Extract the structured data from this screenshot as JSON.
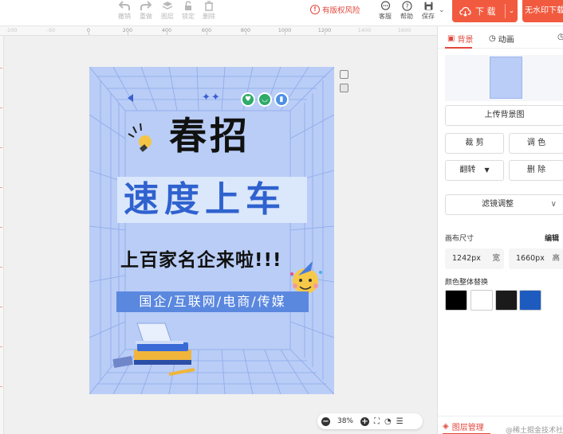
{
  "toolbar": {
    "tools": [
      {
        "label": "撤销",
        "icon": "undo-icon"
      },
      {
        "label": "重做",
        "icon": "redo-icon"
      },
      {
        "label": "图层",
        "icon": "layers-icon"
      },
      {
        "label": "锁定",
        "icon": "lock-icon"
      },
      {
        "label": "删除",
        "icon": "trash-icon"
      }
    ],
    "copyright_risk": "有版权风险",
    "service": "客服",
    "help": "帮助",
    "save": "保存",
    "download": "下 载",
    "no_watermark_download": "无水印下载"
  },
  "ruler": {
    "ticks": [
      "-100",
      "-50",
      "0",
      "200",
      "400",
      "600",
      "800",
      "1000",
      "1200",
      "1400",
      "1600"
    ]
  },
  "poster": {
    "title": "春招",
    "headline": "速度上车",
    "subheadline": "上百家名企来啦!!!",
    "strip": "国企/互联网/电商/传媒",
    "background_color": "#b9cdf6",
    "accent_color": "#2f62cf"
  },
  "zoom": {
    "level": "38%"
  },
  "panel": {
    "tab_background": "背景",
    "tab_animation": "动画",
    "upload_bg": "上传背景图",
    "crop": "裁 剪",
    "tint": "调 色",
    "flip": "翻转",
    "remove": "删 除",
    "filter": "滤镜调整",
    "canvas_size_label": "画布尺寸",
    "edit": "编辑",
    "width_value": "1242px",
    "width_unit": "宽",
    "height_value": "1660px",
    "height_unit": "高",
    "color_replace_label": "颜色整体替换",
    "swatches": [
      "#000000",
      "#ffffff",
      "#1a1a1a",
      "#1e5bbf"
    ],
    "layer_manager": "图层管理"
  },
  "watermark": "@稀土掘金技术社区"
}
